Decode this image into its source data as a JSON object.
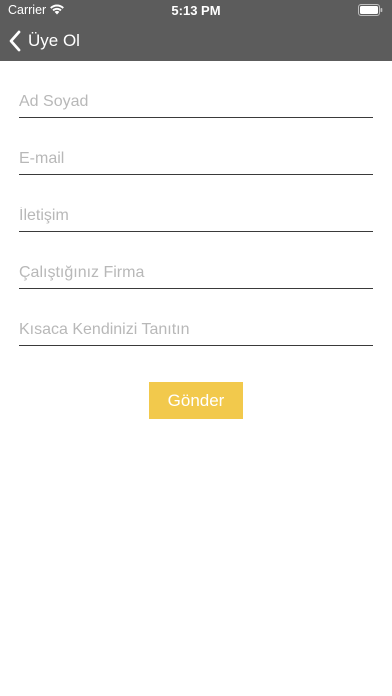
{
  "status_bar": {
    "carrier": "Carrier",
    "time": "5:13 PM"
  },
  "nav": {
    "back_label": "Üye Ol"
  },
  "form": {
    "fields": [
      {
        "placeholder": "Ad Soyad",
        "value": ""
      },
      {
        "placeholder": "E-mail",
        "value": ""
      },
      {
        "placeholder": "İletişim",
        "value": ""
      },
      {
        "placeholder": "Çalıştığınız Firma",
        "value": ""
      },
      {
        "placeholder": "Kısaca Kendinizi Tanıtın",
        "value": ""
      }
    ],
    "submit_label": "Gönder"
  },
  "colors": {
    "header_bg": "#5c5c5c",
    "accent": "#f2c94c"
  }
}
